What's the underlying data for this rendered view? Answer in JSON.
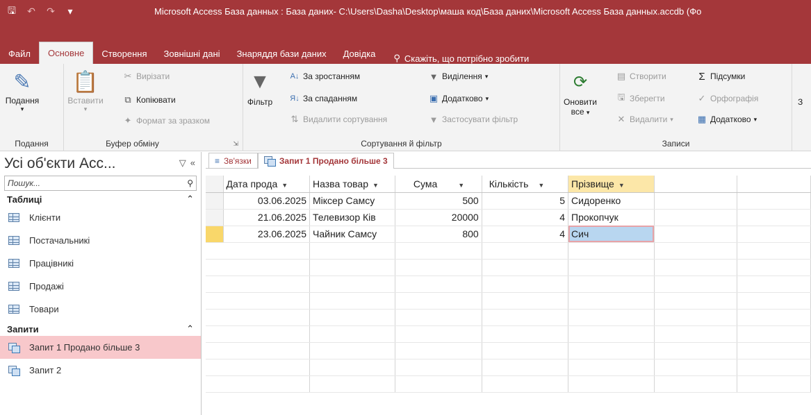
{
  "title_bar": {
    "text": "Microsoft Access База данных : База даних- C:\\Users\\Dasha\\Desktop\\маша код\\База даних\\Microsoft Access База данных.accdb (Фо"
  },
  "menu_tabs": [
    "Файл",
    "Основне",
    "Створення",
    "Зовнішні дані",
    "Знаряддя бази даних",
    "Довідка"
  ],
  "active_tab": "Основне",
  "tell_me": "Скажіть, що потрібно зробити",
  "ribbon": {
    "views": {
      "button": "Подання",
      "label": "Подання"
    },
    "clipboard": {
      "paste": "Вставити",
      "cut": "Вирізати",
      "copy": "Копіювати",
      "format_painter": "Формат за зразком",
      "label": "Буфер обміну"
    },
    "sort_filter": {
      "filter": "Фільтр",
      "ascending": "За зростанням",
      "descending": "За спаданням",
      "remove_sort": "Видалити сортування",
      "selection": "Виділення",
      "advanced": "Додатково",
      "apply_filter": "Застосувати фільтр",
      "label": "Сортування й фільтр"
    },
    "records": {
      "refresh": "Оновити",
      "refresh_all": "все",
      "new": "Створити",
      "save": "Зберегти",
      "delete": "Видалити",
      "totals": "Підсумки",
      "spelling": "Орфографія",
      "more": "Додатково",
      "label": "Записи"
    },
    "extra_cut": "З"
  },
  "nav_pane": {
    "title": "Усі об'єкти Acc...",
    "search_placeholder": "Пошук...",
    "sections": [
      {
        "name": "Таблиці",
        "items": [
          "Клієнти",
          "Постачальникі",
          "Працівникі",
          "Продажі",
          "Товари"
        ]
      },
      {
        "name": "Запити",
        "items": [
          "Запит 1 Продано більше 3",
          "Запит 2"
        ]
      }
    ],
    "selected_item": "Запит 1 Продано більше 3"
  },
  "doc_tabs": [
    "Зв'язки",
    "Запит 1 Продано більше 3"
  ],
  "grid": {
    "columns": [
      "Дата прода",
      "Назва товар",
      "Сума",
      "Кількість",
      "Прізвище"
    ],
    "rows": [
      [
        "03.06.2025",
        "Міксер Самсу",
        "500",
        "5",
        "Сидоренко"
      ],
      [
        "21.06.2025",
        "Телевизор Ків",
        "20000",
        "4",
        "Прокопчук"
      ],
      [
        "23.06.2025",
        "Чайник Самсу",
        "800",
        "4",
        "Сич"
      ]
    ]
  }
}
